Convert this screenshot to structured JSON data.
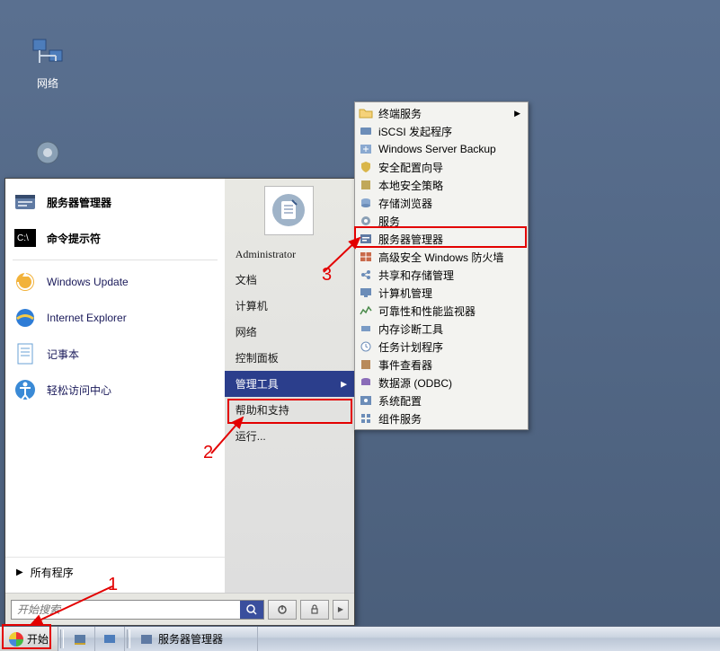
{
  "desktop": {
    "network_label": "网络"
  },
  "start_menu": {
    "left_items": [
      {
        "label": "服务器管理器",
        "bold": true,
        "icon": "server-manager"
      },
      {
        "label": "命令提示符",
        "bold": true,
        "icon": "cmd"
      },
      {
        "label": "Windows Update",
        "bold": false,
        "icon": "windows-update"
      },
      {
        "label": "Internet Explorer",
        "bold": false,
        "icon": "ie"
      },
      {
        "label": "记事本",
        "bold": false,
        "icon": "notepad"
      },
      {
        "label": "轻松访问中心",
        "bold": false,
        "icon": "ease-of-access"
      }
    ],
    "all_programs": "所有程序",
    "user_name": "Administrator",
    "right_items": [
      {
        "label": "文档",
        "has_sub": false
      },
      {
        "label": "计算机",
        "has_sub": false
      },
      {
        "label": "网络",
        "has_sub": false
      },
      {
        "label": "控制面板",
        "has_sub": false
      },
      {
        "label": "管理工具",
        "has_sub": true,
        "highlighted": true
      },
      {
        "label": "帮助和支持",
        "has_sub": false
      },
      {
        "label": "运行...",
        "has_sub": false
      }
    ],
    "search_placeholder": "开始搜索"
  },
  "submenu": {
    "items": [
      {
        "label": "终端服务",
        "has_sub": true,
        "icon": "folder"
      },
      {
        "label": "iSCSI 发起程序",
        "icon": "iscsi"
      },
      {
        "label": "Windows Server Backup",
        "icon": "backup"
      },
      {
        "label": "安全配置向导",
        "icon": "security-wizard"
      },
      {
        "label": "本地安全策略",
        "icon": "local-security"
      },
      {
        "label": "存储浏览器",
        "icon": "storage-explorer"
      },
      {
        "label": "服务",
        "icon": "services"
      },
      {
        "label": "服务器管理器",
        "icon": "server-manager",
        "highlight_box": true
      },
      {
        "label": "高级安全 Windows 防火墙",
        "icon": "firewall"
      },
      {
        "label": "共享和存储管理",
        "icon": "share-storage"
      },
      {
        "label": "计算机管理",
        "icon": "computer-mgmt"
      },
      {
        "label": "可靠性和性能监视器",
        "icon": "perfmon"
      },
      {
        "label": "内存诊断工具",
        "icon": "memory-diag"
      },
      {
        "label": "任务计划程序",
        "icon": "task-scheduler"
      },
      {
        "label": "事件查看器",
        "icon": "event-viewer"
      },
      {
        "label": "数据源 (ODBC)",
        "icon": "odbc"
      },
      {
        "label": "系统配置",
        "icon": "msconfig"
      },
      {
        "label": "组件服务",
        "icon": "component-services"
      }
    ]
  },
  "taskbar": {
    "start_label": "开始",
    "app1": "服务器管理器"
  },
  "annotations": {
    "n1": "1",
    "n2": "2",
    "n3": "3"
  }
}
